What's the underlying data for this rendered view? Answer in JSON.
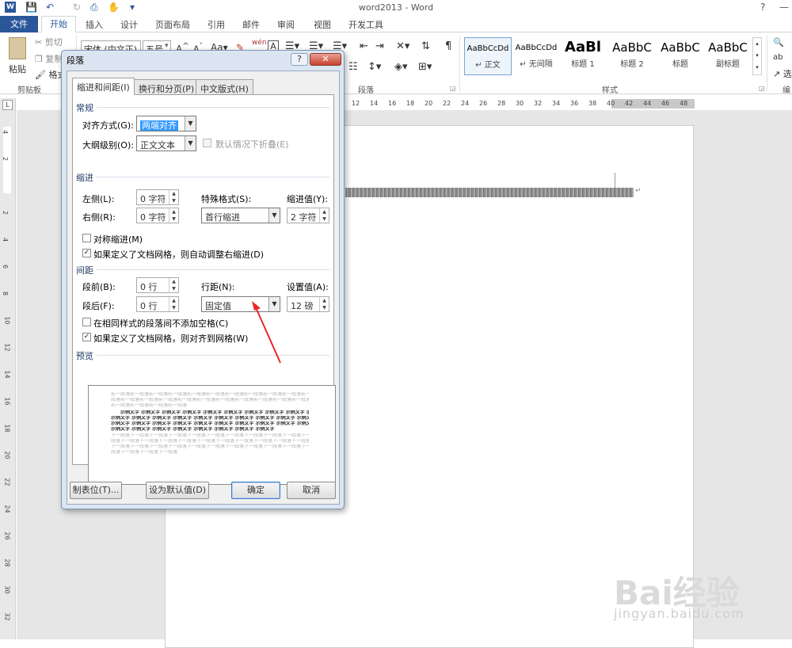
{
  "window": {
    "title": "word2013 - Word",
    "help": "?",
    "minimize": "—",
    "restore": "□"
  },
  "tabs": [
    "文件",
    "开始",
    "插入",
    "设计",
    "页面布局",
    "引用",
    "邮件",
    "审阅",
    "视图",
    "开发工具"
  ],
  "ribbon": {
    "paste": "粘贴",
    "cut": "剪切",
    "copy": "复制",
    "format_painter": "格式",
    "clipboard_group": "剪贴板",
    "font_name": "宋体 (中文正)",
    "font_size": "五号",
    "font_size_arrow": "▾",
    "paragraph_group": "段落",
    "styles_group": "样式",
    "editing_group": "编",
    "select_label": "选",
    "styles": [
      {
        "preview": "AaBbCcDd",
        "name": "↵ 正文"
      },
      {
        "preview": "AaBbCcDd",
        "name": "↵ 无间隔"
      },
      {
        "preview": "AaBl",
        "name": "标题 1"
      },
      {
        "preview": "AaBbC",
        "name": "标题 2"
      },
      {
        "preview": "AaBbC",
        "name": "标题"
      },
      {
        "preview": "AaBbC",
        "name": "副标题"
      }
    ]
  },
  "ruler": {
    "h_ticks": [
      "12",
      "14",
      "16",
      "18",
      "20",
      "22",
      "24",
      "26",
      "28",
      "30",
      "32",
      "34",
      "36",
      "38",
      "40",
      "42",
      "44",
      "46",
      "48"
    ],
    "v_ticks": [
      "4",
      "2",
      "",
      "2",
      "4",
      "6",
      "8",
      "10",
      "12",
      "14",
      "16",
      "18",
      "20",
      "22",
      "24",
      "26",
      "28",
      "30",
      "32"
    ],
    "corner": "L"
  },
  "dialog": {
    "title": "段落",
    "help": "?",
    "close": "✕",
    "tabs": [
      "缩进和间距(I)",
      "换行和分页(P)",
      "中文版式(H)"
    ],
    "general": {
      "section": "常规",
      "alignment_label": "对齐方式(G):",
      "alignment_value": "两端对齐",
      "outline_label": "大纲级别(O):",
      "outline_value": "正文文本",
      "collapse_label": "默认情况下折叠(E)"
    },
    "indent": {
      "section": "缩进",
      "left_label": "左侧(L):",
      "left_value": "0 字符",
      "right_label": "右侧(R):",
      "right_value": "0 字符",
      "special_label": "特殊格式(S):",
      "special_value": "首行缩进",
      "by_label": "缩进值(Y):",
      "by_value": "2 字符",
      "mirror_label": "对称缩进(M)",
      "mirror_checked": false,
      "auto_adjust_label": "如果定义了文档网格，则自动调整右缩进(D)",
      "auto_adjust_checked": true
    },
    "spacing": {
      "section": "间距",
      "before_label": "段前(B):",
      "before_value": "0 行",
      "after_label": "段后(F):",
      "after_value": "0 行",
      "line_label": "行距(N):",
      "line_value": "固定值",
      "at_label": "设置值(A):",
      "at_value": "12 磅",
      "no_space_label": "在相同样式的段落间不添加空格(C)",
      "no_space_checked": false,
      "snap_grid_label": "如果定义了文档网格，则对齐到网格(W)",
      "snap_grid_checked": true
    },
    "preview": {
      "section": "预览",
      "lines": [
        "前一段落前一段落前一段落前一段落前一段落前一段落前一段落前一段落前一段落前一段落前一段落前一段落",
        "段落前一段落前一段落前一段落前一段落前一段落前一段落前一段落前一段落前一段落前一段落前一段落前一",
        "前一段落前一段落前一段落前一段落",
        "示例文字 示例文字 示例文字 示例文字 示例文字 示例文字 示例文字 示例文字 示例文字 示例文字",
        "示例文字 示例文字 示例文字 示例文字 示例文字 示例文字 示例文字 示例文字 示例文字 示例文字",
        "示例文字 示例文字 示例文字 示例文字 示例文字 示例文字 示例文字 示例文字 示例文字 示例文字",
        "示例文字 示例文字 示例文字 示例文字 示例文字 示例文字 示例文字 示例文字",
        "下一段落下一段落下一段落下一段落下一段落下一段落下一段落下一段落下一段落下一段落下一段落下一",
        "段落下一段落下一段落下一段落下一段落下一段落下一段落下一段落下一段落下一段落下一段落下一段落",
        "下一段落下一段落下一段落下一段落下一段落下一段落下一段落下一段落下一段落下一段落下一段落下一",
        "段落下一段落下一段落下一段落"
      ]
    },
    "buttons": {
      "tabs": "制表位(T)...",
      "set_default": "设为默认值(D)",
      "ok": "确定",
      "cancel": "取消"
    }
  },
  "watermark": {
    "logo": "Bai经验",
    "url": "jingyan.baidu.com"
  },
  "colors": {
    "accent": "#2b579a",
    "annotation_arrow": "#e8262b"
  }
}
